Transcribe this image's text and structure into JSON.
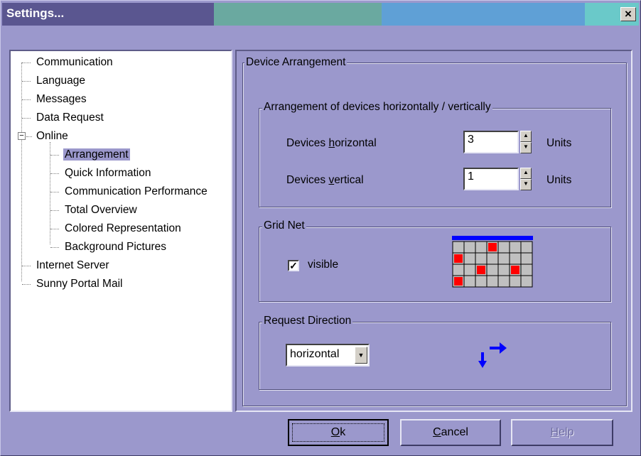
{
  "window": {
    "title": "Settings...",
    "close_glyph": "×"
  },
  "tree": {
    "items": [
      {
        "label": "Communication"
      },
      {
        "label": "Language"
      },
      {
        "label": "Messages"
      },
      {
        "label": "Data Request"
      },
      {
        "label": "Online"
      },
      {
        "label": "Arrangement"
      },
      {
        "label": "Quick Information"
      },
      {
        "label": "Communication Performance"
      },
      {
        "label": "Total Overview"
      },
      {
        "label": "Colored Representation"
      },
      {
        "label": "Background Pictures"
      },
      {
        "label": "Internet Server"
      },
      {
        "label": "Sunny Portal Mail"
      }
    ],
    "expander_glyph": "−"
  },
  "panel": {
    "title": "Device Arrangement",
    "arrangement_group": {
      "title": "Arrangement of devices horizontally / vertically",
      "horizontal": {
        "label_pre": "Devices ",
        "label_mnemonic": "h",
        "label_post": "orizontal",
        "value": "3",
        "unit": "Units"
      },
      "vertical": {
        "label_pre": "Devices ",
        "label_mnemonic": "v",
        "label_post": "ertical",
        "value": "1",
        "unit": "Units"
      }
    },
    "grid_group": {
      "title": "Grid Net",
      "visible_label": "visible",
      "check_glyph": "✓",
      "red_cells": [
        [
          0,
          3
        ],
        [
          1,
          0
        ],
        [
          2,
          2
        ],
        [
          2,
          5
        ],
        [
          3,
          0
        ]
      ],
      "colors": {
        "cell": "#c0c0c0",
        "highlight": "#ff0000",
        "bar": "#0000ff",
        "line": "#000000"
      }
    },
    "request_group": {
      "title": "Request Direction",
      "selected": "horizontal",
      "icon": "direction-arrows-icon"
    }
  },
  "buttons": {
    "ok": {
      "mnemonic": "O",
      "rest": "k"
    },
    "cancel": {
      "mnemonic": "C",
      "rest": "ancel"
    },
    "help": {
      "mnemonic": "H",
      "rest": "elp"
    }
  },
  "colors": {
    "background": "#9b98cc",
    "arrow": "#0000ff"
  }
}
